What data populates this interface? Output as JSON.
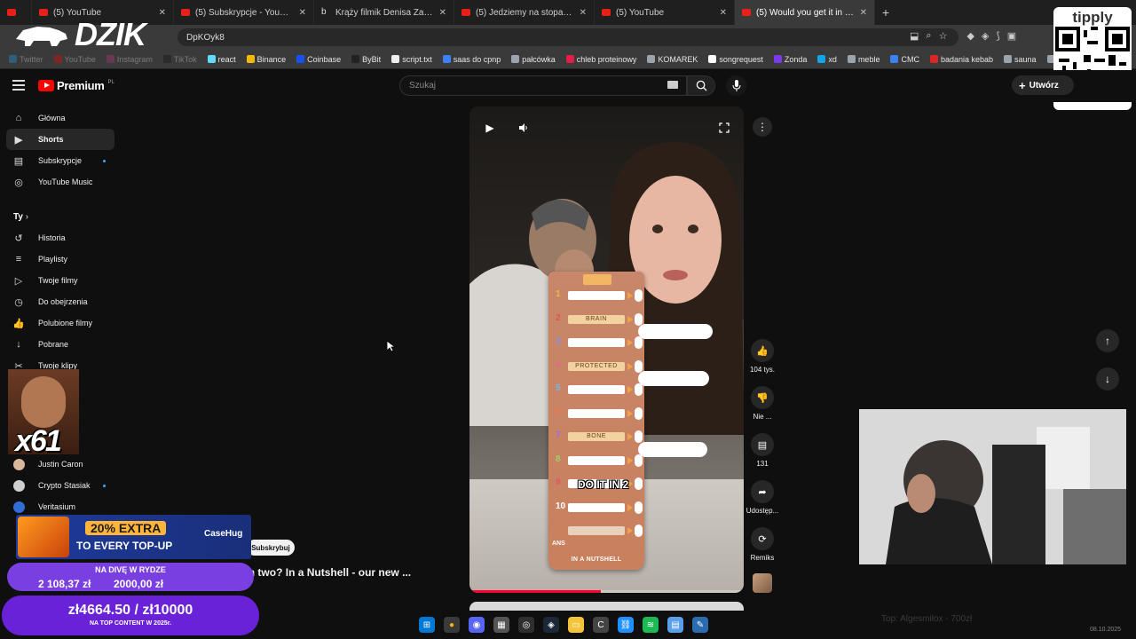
{
  "browser": {
    "tabs": [
      {
        "title": "(5) YouTube",
        "active": false
      },
      {
        "title": "(5) Subskrypcje - YouTube",
        "active": false
      },
      {
        "title": "Krąży filmik Denisa Załęckiego",
        "active": false
      },
      {
        "title": "(5) Jedziemy na stopa do Niem",
        "active": false
      },
      {
        "title": "(5) YouTube",
        "active": false
      },
      {
        "title": "(5) Would you get it in two? In",
        "active": true
      }
    ],
    "address_fragment": "DpKOyk8",
    "bookmarks": [
      "Twitter",
      "YouTube",
      "Instagram",
      "TikTok",
      "react",
      "Binance",
      "Coinbase",
      "ByBit",
      "script.txt",
      "saas do cpnp",
      "pałcówka",
      "chleb proteinowy",
      "KOMAREK",
      "songrequest",
      "Zonda",
      "xd",
      "meble",
      "CMC",
      "badania kebab",
      "sauna",
      "prawo jazdy"
    ]
  },
  "overlay": {
    "logo_text": "DZIK",
    "tipply_text": "tipply",
    "emote_count": "x61",
    "promo_line1": "20% EXTRA",
    "promo_line2": "TO EVERY TOP-UP",
    "promo_brand": "CaseHug",
    "goal1_title": "NA DIVĘ W RYDZE",
    "goal1_current": "2 108,37 zł",
    "goal1_target": "2000,00 zł",
    "goal2_amounts": "zł4664.50 / zł10000",
    "goal2_caption": "NA TOP CONTENT W 2025r.",
    "ghost_text": "Top: Algesmilox - 700zł"
  },
  "youtube": {
    "brand": "Premium",
    "brand_country": "PL",
    "search_placeholder": "Szukaj",
    "create_label": "Utwórz",
    "nav": [
      {
        "label": "Główna",
        "icon": "home-icon"
      },
      {
        "label": "Shorts",
        "icon": "shorts-icon"
      },
      {
        "label": "Subskrypcje",
        "icon": "subscriptions-icon"
      },
      {
        "label": "YouTube Music",
        "icon": "music-icon"
      }
    ],
    "you_section": "Ty",
    "you_items": [
      {
        "label": "Historia",
        "icon": "history-icon"
      },
      {
        "label": "Playlisty",
        "icon": "playlists-icon"
      },
      {
        "label": "Twoje filmy",
        "icon": "your-videos-icon"
      },
      {
        "label": "Do obejrzenia",
        "icon": "watch-later-icon"
      },
      {
        "label": "Polubione filmy",
        "icon": "liked-icon"
      },
      {
        "label": "Pobrane",
        "icon": "download-icon"
      },
      {
        "label": "Twoje klipy",
        "icon": "clips-icon"
      }
    ],
    "subscriptions": [
      {
        "name": "Justin Caron",
        "color": "#d8b79a"
      },
      {
        "name": "Crypto Stasiak",
        "color": "#cfcfcf"
      },
      {
        "name": "Veritasium",
        "color": "#2f6fd6"
      }
    ],
    "short": {
      "title": "Would you get it in two? In a Nutshell - our new ...",
      "subscribe_label": "Subskrybuj",
      "caption": "DO IT IN 2",
      "progress": 0.48,
      "board_words": {
        "2": "BRAIN",
        "4": "PROTECTED",
        "7": "BONE"
      },
      "board_footer": "IN A NUTSHELL",
      "ans_label": "ANS"
    },
    "actions": {
      "like_count": "104 tys.",
      "dislike_label": "Nie ...",
      "comments_count": "131",
      "share_label": "Udostęp...",
      "remix_label": "Remiks"
    }
  },
  "taskbar": {
    "clock": "08.10.2025"
  }
}
